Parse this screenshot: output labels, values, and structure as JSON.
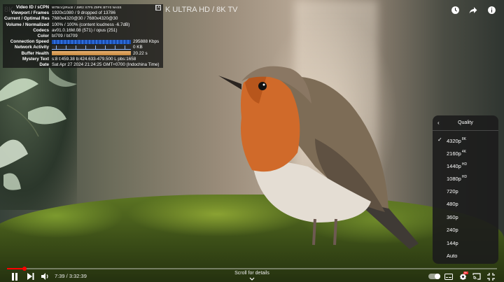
{
  "video": {
    "title_partial": "8K",
    "title_rest": "K ULTRA HD / 8K TV"
  },
  "top_icons": [
    "watch-later-icon",
    "share-icon",
    "info-icon"
  ],
  "stats": {
    "close_label": "[X]",
    "rows": [
      {
        "key": "Video ID / sCPN",
        "value": "W7BcVjJRxcE / J9R2 X7F5 Z9PK BTY0 NASS"
      },
      {
        "key": "Viewport / Frames",
        "value": "1920x1080 / 9 dropped of 13786"
      },
      {
        "key": "Current / Optimal Res",
        "value": "7680x4320@30 / 7680x4320@30"
      },
      {
        "key": "Volume / Normalized",
        "value": "100% / 100% (content loudness -6.7dB)"
      },
      {
        "key": "Codecs",
        "value": "av01.0.16M.08 (571) / opus (251)"
      },
      {
        "key": "Color",
        "value": "bt709 / bt709"
      },
      {
        "key": "Connection Speed",
        "value": "295888 Kbps",
        "bar": "speed"
      },
      {
        "key": "Network Activity",
        "value": "0 KB",
        "bar": "net"
      },
      {
        "key": "Buffer Health",
        "value": "20.22 s",
        "bar": "buf"
      },
      {
        "key": "Mystery Text",
        "value": "s:8 t:459.38 b:424.633-479.500 L pbs:1658"
      },
      {
        "key": "Date",
        "value": "Sat Apr 27 2024 21:24:25 GMT+0700 (Indochina Time)"
      }
    ]
  },
  "quality_menu": {
    "back_icon": "chevron-left-icon",
    "title": "Quality",
    "selected": "4320p",
    "options": [
      {
        "label": "4320p",
        "badge": "8K"
      },
      {
        "label": "2160p",
        "badge": "4K"
      },
      {
        "label": "1440p",
        "badge": "HD"
      },
      {
        "label": "1080p",
        "badge": "HD"
      },
      {
        "label": "720p",
        "badge": ""
      },
      {
        "label": "480p",
        "badge": ""
      },
      {
        "label": "360p",
        "badge": ""
      },
      {
        "label": "240p",
        "badge": ""
      },
      {
        "label": "144p",
        "badge": ""
      },
      {
        "label": "Auto",
        "badge": ""
      }
    ]
  },
  "player": {
    "current_time": "7:39",
    "duration": "3:32:39",
    "time_display": "7:39 / 3:32:39",
    "progress_fraction": 0.036,
    "scroll_hint": "Scroll for details",
    "autoplay_on": true,
    "settings_badge": "8K",
    "progress_color": "#ff0000"
  }
}
